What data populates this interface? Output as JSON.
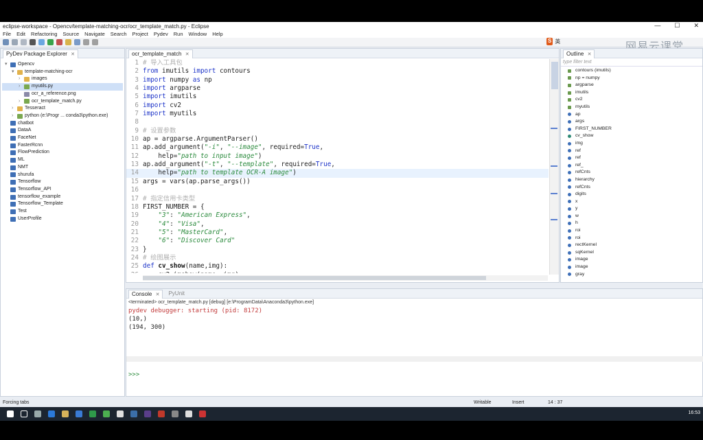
{
  "window": {
    "title": "eclipse-workspace - Opencv/template-matching-ocr/ocr_template_match.py - Eclipse",
    "controls": [
      "—",
      "☐",
      "✕"
    ]
  },
  "menu": [
    "File",
    "Edit",
    "Refactoring",
    "Source",
    "Navigate",
    "Search",
    "Project",
    "Pydev",
    "Run",
    "Window",
    "Help"
  ],
  "watermark": "网易云课堂",
  "ime": {
    "logo": "S",
    "label": "英"
  },
  "explorer": {
    "title": "PyDev Package Explorer",
    "tree": [
      {
        "label": "Opencv",
        "kind": "proj",
        "indent": 0,
        "arrow": "▾"
      },
      {
        "label": "template-matching-ocr",
        "kind": "folder",
        "indent": 1,
        "arrow": "▾"
      },
      {
        "label": "images",
        "kind": "folder",
        "indent": 2,
        "arrow": "›"
      },
      {
        "label": "myutils.py",
        "kind": "pyfile",
        "indent": 2,
        "arrow": "›",
        "selected": true
      },
      {
        "label": "ocr_a_reference.png",
        "kind": "imgfile",
        "indent": 2,
        "arrow": ""
      },
      {
        "label": "ocr_template_match.py",
        "kind": "pyfile",
        "indent": 2,
        "arrow": "›"
      },
      {
        "label": "Tesseract",
        "kind": "folder",
        "indent": 1,
        "arrow": "›"
      },
      {
        "label": "python  (e:\\Progr ... conda3\\python.exe)",
        "kind": "pyfile",
        "indent": 1,
        "arrow": "›"
      },
      {
        "label": "chatbot",
        "kind": "proj",
        "indent": 0,
        "arrow": ""
      },
      {
        "label": "DataA",
        "kind": "proj",
        "indent": 0,
        "arrow": ""
      },
      {
        "label": "FaceNet",
        "kind": "proj",
        "indent": 0,
        "arrow": ""
      },
      {
        "label": "FasterRcnn",
        "kind": "proj",
        "indent": 0,
        "arrow": ""
      },
      {
        "label": "FlowPrediction",
        "kind": "proj",
        "indent": 0,
        "arrow": ""
      },
      {
        "label": "ML",
        "kind": "proj",
        "indent": 0,
        "arrow": ""
      },
      {
        "label": "NMT",
        "kind": "proj",
        "indent": 0,
        "arrow": ""
      },
      {
        "label": "shurufa",
        "kind": "proj",
        "indent": 0,
        "arrow": ""
      },
      {
        "label": "Tensorflow",
        "kind": "proj",
        "indent": 0,
        "arrow": ""
      },
      {
        "label": "Tensorflow_API",
        "kind": "proj",
        "indent": 0,
        "arrow": ""
      },
      {
        "label": "tensorflow_example",
        "kind": "proj",
        "indent": 0,
        "arrow": ""
      },
      {
        "label": "Tensorflow_Template",
        "kind": "proj",
        "indent": 0,
        "arrow": ""
      },
      {
        "label": "Test",
        "kind": "proj",
        "indent": 0,
        "arrow": ""
      },
      {
        "label": "UserProfile",
        "kind": "proj",
        "indent": 0,
        "arrow": ""
      }
    ]
  },
  "editor": {
    "tab": "ocr_template_match",
    "lines": [
      {
        "n": "1",
        "html": "<span class='cm'># 导入工具包</span>"
      },
      {
        "n": "2",
        "html": "<span class='kw'>from</span> imutils <span class='kw'>import</span> contours"
      },
      {
        "n": "3",
        "html": "<span class='kw'>import</span> numpy <span class='kw'>as</span> np"
      },
      {
        "n": "4",
        "html": "<span class='kw'>import</span> argparse"
      },
      {
        "n": "5",
        "html": "<span class='kw'>import</span> imutils"
      },
      {
        "n": "6",
        "html": "<span class='kw'>import</span> cv2"
      },
      {
        "n": "7",
        "html": "<span class='kw'>import</span> myutils"
      },
      {
        "n": "8",
        "html": ""
      },
      {
        "n": "9",
        "html": "<span class='cm'># 设置参数</span>"
      },
      {
        "n": "10",
        "html": "ap = argparse.ArgumentParser()"
      },
      {
        "n": "11",
        "html": "ap.add_argument(<span class='str'>\"-i\"</span>, <span class='str'>\"--image\"</span>, required=<span class='kw'>True</span>,"
      },
      {
        "n": "12",
        "html": "    help=<span class='str'>\"path to input image\"</span>)"
      },
      {
        "n": "13",
        "html": "ap.add_argument(<span class='str'>\"-t\"</span>, <span class='str'>\"--template\"</span>, required=<span class='kw'>True</span>,"
      },
      {
        "n": "14",
        "html": "    help=<span class='str'>\"path to template OCR-A image\"</span>)",
        "highlight": true
      },
      {
        "n": "15",
        "html": "args = vars(ap.parse_args())"
      },
      {
        "n": "16",
        "html": ""
      },
      {
        "n": "17",
        "html": "<span class='cm'># 指定信用卡类型</span>"
      },
      {
        "n": "18",
        "html": "FIRST_NUMBER = {"
      },
      {
        "n": "19",
        "html": "    <span class='str'>\"3\"</span>: <span class='str'>\"American Express\"</span>,"
      },
      {
        "n": "20",
        "html": "    <span class='str'>\"4\"</span>: <span class='str'>\"Visa\"</span>,"
      },
      {
        "n": "21",
        "html": "    <span class='str'>\"5\"</span>: <span class='str'>\"MasterCard\"</span>,"
      },
      {
        "n": "22",
        "html": "    <span class='str'>\"6\"</span>: <span class='str'>\"Discover Card\"</span>"
      },
      {
        "n": "23",
        "html": "}"
      },
      {
        "n": "24",
        "html": "<span class='cm'># 绘图展示</span>"
      },
      {
        "n": "25",
        "html": "<span class='kw'>def</span> <span class='fn'>cv_show</span>(name,img):"
      },
      {
        "n": "26",
        "html": "    cv2.imshow(name, img)"
      }
    ]
  },
  "outline": {
    "title": "Outline",
    "filter_placeholder": "type filter text",
    "items": [
      {
        "label": "contours (imutils)",
        "kind": "imp"
      },
      {
        "label": "np = numpy",
        "kind": "imp"
      },
      {
        "label": "argparse",
        "kind": "imp"
      },
      {
        "label": "imutils",
        "kind": "imp"
      },
      {
        "label": "cv2",
        "kind": "imp"
      },
      {
        "label": "myutils",
        "kind": "imp"
      },
      {
        "label": "ap",
        "kind": "var"
      },
      {
        "label": "args",
        "kind": "var"
      },
      {
        "label": "FIRST_NUMBER",
        "kind": "var"
      },
      {
        "label": "cv_show",
        "kind": "fn"
      },
      {
        "label": "img",
        "kind": "var"
      },
      {
        "label": "ref",
        "kind": "var"
      },
      {
        "label": "ref",
        "kind": "var"
      },
      {
        "label": "ref_",
        "kind": "var"
      },
      {
        "label": "refCnts",
        "kind": "var"
      },
      {
        "label": "hierarchy",
        "kind": "var"
      },
      {
        "label": "refCnts",
        "kind": "var"
      },
      {
        "label": "digits",
        "kind": "var"
      },
      {
        "label": "x",
        "kind": "var"
      },
      {
        "label": "y",
        "kind": "var"
      },
      {
        "label": "w",
        "kind": "var"
      },
      {
        "label": "h",
        "kind": "var"
      },
      {
        "label": "roi",
        "kind": "var"
      },
      {
        "label": "roi",
        "kind": "var"
      },
      {
        "label": "rectKernel",
        "kind": "var"
      },
      {
        "label": "sqKernel",
        "kind": "var"
      },
      {
        "label": "image",
        "kind": "var"
      },
      {
        "label": "image",
        "kind": "var"
      },
      {
        "label": "gray",
        "kind": "var"
      }
    ]
  },
  "console": {
    "tabs": [
      "Console",
      "PyUnit"
    ],
    "info": "<terminated> ocr_template_match.py [debug] [e:\\ProgramData\\Anaconda3\\python.exe]",
    "lines": [
      {
        "text": "pydev debugger: starting (pid: 8172)",
        "kind": "red"
      },
      {
        "text": "(10,)",
        "kind": "plain"
      },
      {
        "text": "(194, 300)",
        "kind": "plain"
      }
    ],
    "prompt": ">>>"
  },
  "status": {
    "left": "Forcing tabs",
    "writable": "Writable",
    "insert": "Insert",
    "position": "14 : 37"
  },
  "taskbar": {
    "clock": "16:53"
  }
}
